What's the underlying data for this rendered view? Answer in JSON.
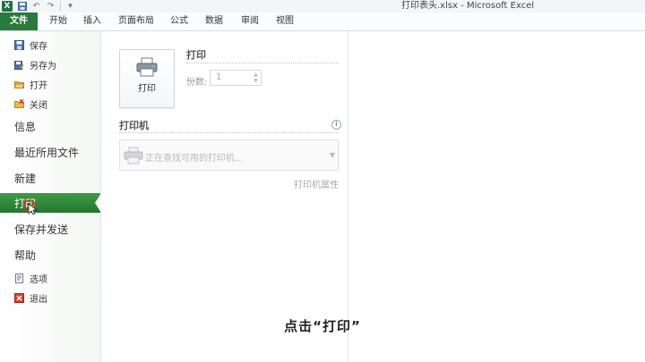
{
  "window": {
    "title": "打印表头.xlsx  -  Microsoft Excel",
    "app_logo_letter": "X"
  },
  "ribbon_tabs": [
    {
      "label": "文件",
      "active": true
    },
    {
      "label": "开始"
    },
    {
      "label": "插入"
    },
    {
      "label": "页面布局"
    },
    {
      "label": "公式"
    },
    {
      "label": "数据"
    },
    {
      "label": "审阅"
    },
    {
      "label": "视图"
    }
  ],
  "backstage_menu": {
    "save": "保存",
    "save_as": "另存为",
    "open": "打开",
    "close": "关闭",
    "info": "信息",
    "recent": "最近所用文件",
    "new": "新建",
    "print": "打印",
    "save_send": "保存并发送",
    "help": "帮助",
    "options": "选项",
    "exit": "退出"
  },
  "print_panel": {
    "print_button_label": "打印",
    "section_print": "打印",
    "copies_label": "份数:",
    "copies_value": "1",
    "section_printer": "打印机",
    "printer_status": "正在查找可用的打印机...",
    "printer_properties": "打印机属性"
  },
  "caption": "点击“打印”",
  "colors": {
    "file_tab": "#2a7a3b",
    "active_menu": "#2f8a39",
    "cursor_highlight": "#e0301e"
  }
}
